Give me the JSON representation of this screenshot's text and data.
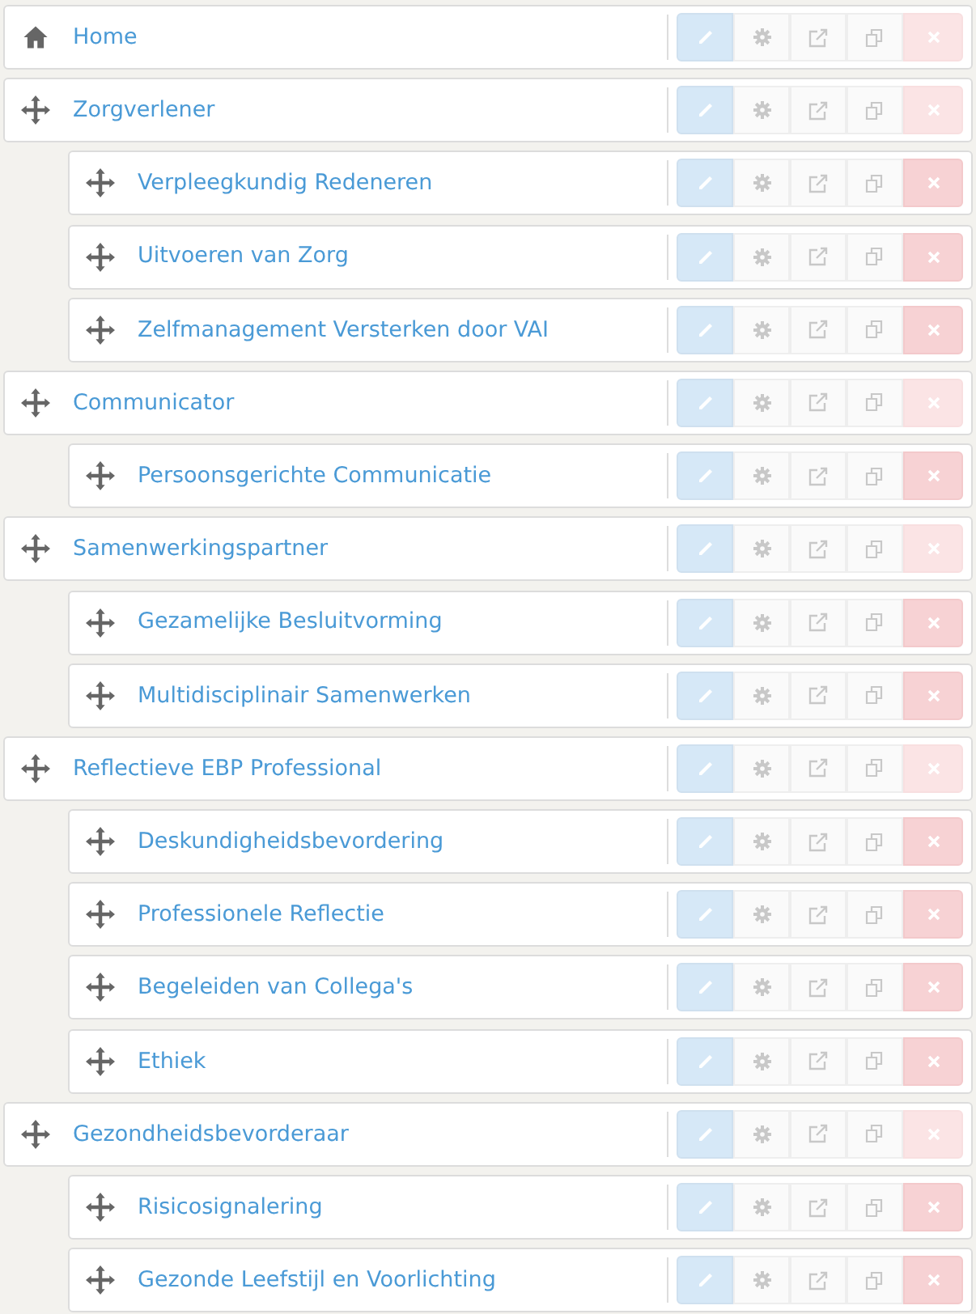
{
  "pages": [
    {
      "label": "Home",
      "kind": "home",
      "delete_disabled": true
    },
    {
      "label": "Zorgverlener",
      "kind": "move",
      "delete_disabled": true,
      "children": [
        {
          "label": "Verpleegkundig Redeneren",
          "kind": "move",
          "delete_disabled": false
        },
        {
          "label": "Uitvoeren van Zorg",
          "kind": "move",
          "delete_disabled": false
        },
        {
          "label": "Zelfmanagement Versterken door VAI",
          "kind": "move",
          "delete_disabled": false
        }
      ]
    },
    {
      "label": "Communicator",
      "kind": "move",
      "delete_disabled": true,
      "children": [
        {
          "label": "Persoonsgerichte Communicatie",
          "kind": "move",
          "delete_disabled": false
        }
      ]
    },
    {
      "label": "Samenwerkingspartner",
      "kind": "move",
      "delete_disabled": true,
      "children": [
        {
          "label": "Gezamelijke Besluitvorming",
          "kind": "move",
          "delete_disabled": false
        },
        {
          "label": "Multidisciplinair Samenwerken",
          "kind": "move",
          "delete_disabled": false
        }
      ]
    },
    {
      "label": "Reflectieve EBP Professional",
      "kind": "move",
      "delete_disabled": true,
      "children": [
        {
          "label": "Deskundigheidsbevordering",
          "kind": "move",
          "delete_disabled": false
        },
        {
          "label": "Professionele Reflectie",
          "kind": "move",
          "delete_disabled": false
        },
        {
          "label": "Begeleiden van Collega's",
          "kind": "move",
          "delete_disabled": false
        },
        {
          "label": "Ethiek",
          "kind": "move",
          "delete_disabled": false
        }
      ]
    },
    {
      "label": "Gezondheidsbevorderaar",
      "kind": "move",
      "delete_disabled": true,
      "children": [
        {
          "label": "Risicosignalering",
          "kind": "move",
          "delete_disabled": false
        },
        {
          "label": "Gezonde Leefstijl en Voorlichting",
          "kind": "move",
          "delete_disabled": false
        }
      ]
    }
  ]
}
